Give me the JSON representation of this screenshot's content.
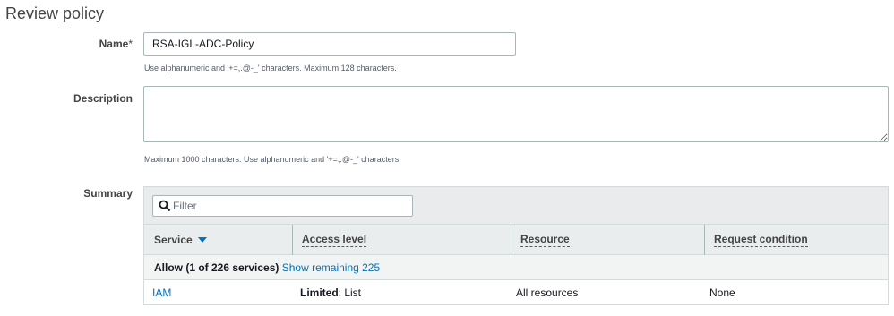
{
  "page": {
    "title": "Review policy"
  },
  "name_field": {
    "label": "Name",
    "required_mark": "*",
    "value": "RSA-IGL-ADC-Policy",
    "hint": "Use alphanumeric and '+=,.@-_' characters. Maximum 128 characters."
  },
  "description_field": {
    "label": "Description",
    "value": "",
    "hint": "Maximum 1000 characters. Use alphanumeric and '+=,.@-_' characters."
  },
  "summary": {
    "label": "Summary",
    "filter_placeholder": "Filter",
    "columns": [
      "Service",
      "Access level",
      "Resource",
      "Request condition"
    ],
    "group": {
      "label": "Allow (1 of 226 services)",
      "link": "Show remaining 225"
    },
    "rows": [
      {
        "service": "IAM",
        "access_level_strong": "Limited",
        "access_level_rest": ": List",
        "resource": "All resources",
        "request_condition": "None"
      }
    ]
  },
  "colors": {
    "link": "#0073bb",
    "header_bg": "#eaeded",
    "border": "#aab7b8"
  }
}
